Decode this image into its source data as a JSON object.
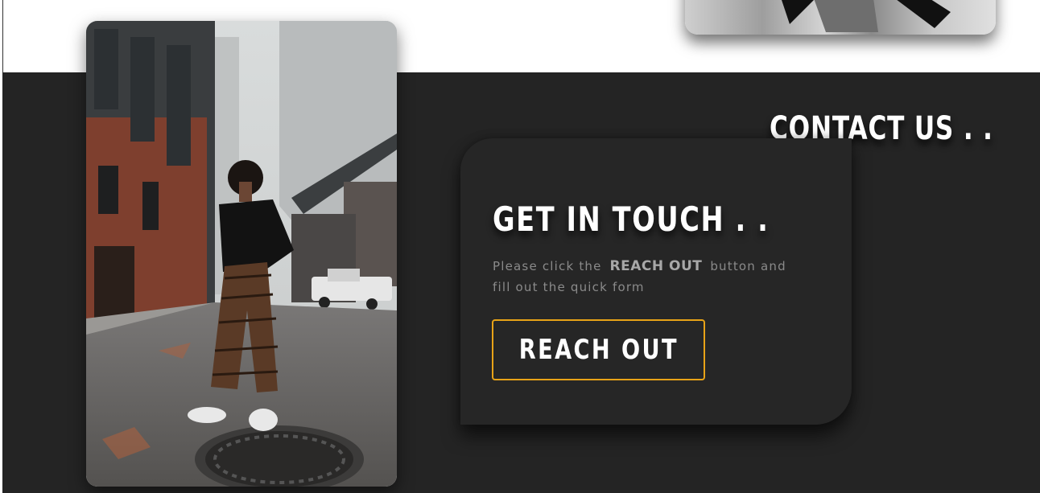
{
  "contact": {
    "heading": "CONTACT US . ."
  },
  "card": {
    "title": "GET IN TOUCH . .",
    "text_before": "Please click the",
    "text_highlight": "REACH OUT",
    "text_after": "button and fill out the quick form",
    "button_label": "REACH OUT",
    "button_border_color": "#e8a317"
  },
  "colors": {
    "section_background": "#242424",
    "card_background": "#262626",
    "heading_text": "#ffffff",
    "body_text": "#8a8a8a"
  },
  "images": {
    "top_photo": "fashion-photo-grayscale",
    "main_photo": "woman-standing-on-city-street-photo"
  }
}
